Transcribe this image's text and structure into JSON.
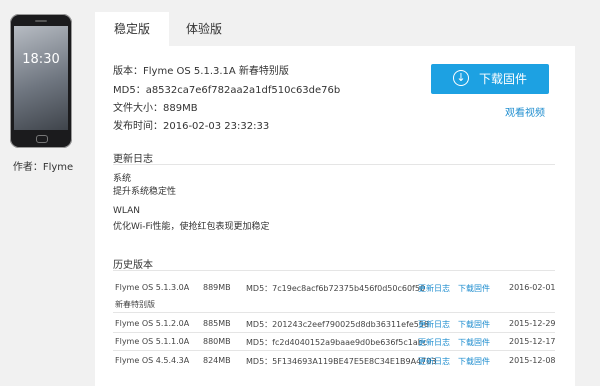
{
  "sidebar": {
    "phone_time": "18:30",
    "author": "作者：Flyme"
  },
  "tabs": [
    {
      "label": "稳定版",
      "active": true
    },
    {
      "label": "体验版",
      "active": false
    }
  ],
  "firmware": {
    "version": "版本：Flyme OS 5.1.3.1A 新春特别版",
    "md5": "MD5：a8532ca7e6f782aa2a1df510c63de76b",
    "size": "文件大小：889MB",
    "release": "发布时间：2016-02-03 23:32:33",
    "download_label": "下载固件",
    "video_label": "观看视频"
  },
  "changelog": {
    "title": "更新日志",
    "groups": [
      {
        "category": "系统",
        "item": "提升系统稳定性"
      },
      {
        "category": "WLAN",
        "item": "优化Wi-Fi性能，使抢红包表现更加稳定"
      }
    ]
  },
  "history": {
    "title": "历史版本",
    "rows": [
      {
        "name": "Flyme OS 5.1.3.0A",
        "sub": "新春特别版",
        "size": "889MB",
        "md5": "MD5：7c19ec8acf6b72375b456f0d50c60f50",
        "log": "更新日志",
        "dl": "下载固件",
        "date": "2016-02-01"
      },
      {
        "name": "Flyme OS 5.1.2.0A",
        "sub": "",
        "size": "885MB",
        "md5": "MD5：201243c2eef790025d8db36311efe558",
        "log": "更新日志",
        "dl": "下载固件",
        "date": "2015-12-29"
      },
      {
        "name": "Flyme OS 5.1.1.0A",
        "sub": "",
        "size": "880MB",
        "md5": "MD5：fc2d4040152a9baae9d0be636f5c1abc",
        "log": "更新日志",
        "dl": "下载固件",
        "date": "2015-12-17"
      },
      {
        "name": "Flyme OS 4.5.4.3A",
        "sub": "",
        "size": "824MB",
        "md5": "MD5：5F134693A119BE47E5E8C34E1B9A4703",
        "log": "更新日志",
        "dl": "下载固件",
        "date": "2015-12-08"
      }
    ]
  },
  "colors": {
    "accent": "#1da1e2",
    "link": "#1e8dcf",
    "background": "#f1f1f1"
  }
}
